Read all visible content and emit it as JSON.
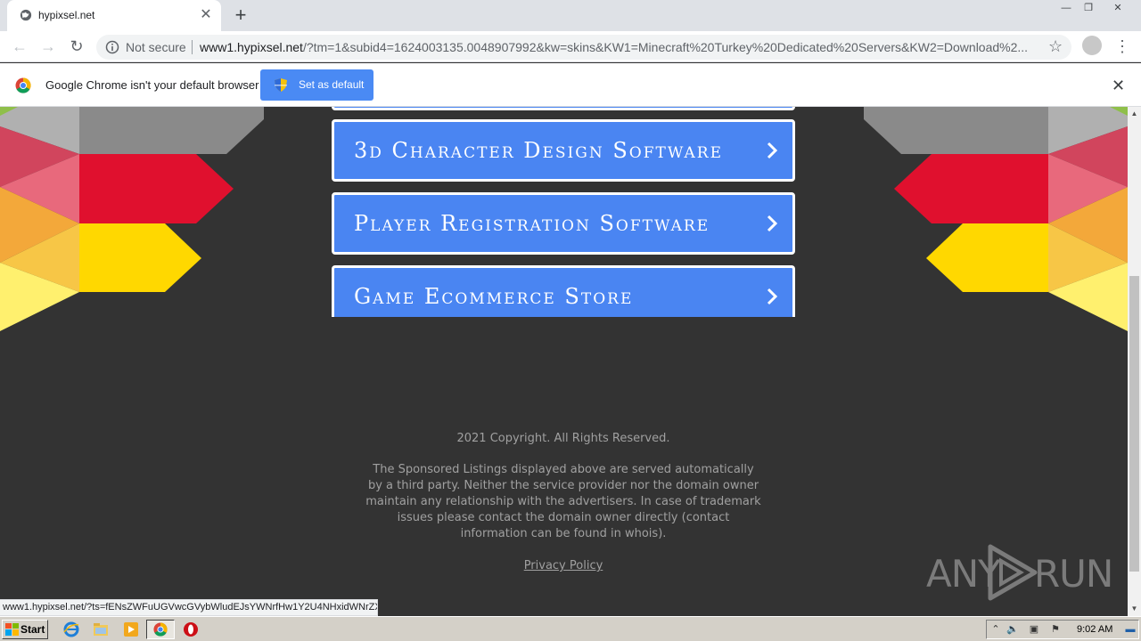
{
  "browser": {
    "tab": {
      "title": "hypixsel.net",
      "close": "✕"
    },
    "new_tab": "+",
    "window": {
      "minimize": "—",
      "restore": "❐",
      "close": "✕"
    },
    "nav": {
      "back": "←",
      "forward": "→",
      "reload": "↻"
    },
    "omnibox": {
      "security": "Not secure",
      "host": "www1.hypixsel.net",
      "path": "/?tm=1&subid4=1624003135.0048907992&kw=skins&KW1=Minecraft%20Turkey%20Dedicated%20Servers&KW2=Download%2..."
    },
    "star": "☆",
    "menu": "⋮",
    "infobar": {
      "message": "Google Chrome isn't your default browser",
      "button": "Set as default",
      "close": "✕"
    },
    "status_url": "www1.hypixsel.net/?ts=fENsZWFuUGVwcGVybWludEJsYWNrfHw1Y2U4NHxidWNrZX..."
  },
  "page": {
    "listings": [
      {
        "label": "3d Character Design Software"
      },
      {
        "label": "Player Registration Software"
      },
      {
        "label": "Game Ecommerce Store"
      }
    ],
    "copyright": "2021 Copyright. All Rights Reserved.",
    "disclaimer": "The Sponsored Listings displayed above are served automatically by a third party. Neither the service provider nor the domain owner maintain any relationship with the advertisers. In case of trademark issues please contact the domain owner directly (contact information can be found in whois).",
    "privacy_link": "Privacy Policy",
    "colors": {
      "listing_bg": "#4a85f2",
      "page_bg": "#333333"
    }
  },
  "watermark": {
    "left": "ANY",
    "right": "RUN"
  },
  "taskbar": {
    "start": "Start",
    "time": "9:02 AM",
    "icons": [
      "ie-icon",
      "explorer-icon",
      "media-player-icon",
      "chrome-icon",
      "opera-icon"
    ]
  }
}
